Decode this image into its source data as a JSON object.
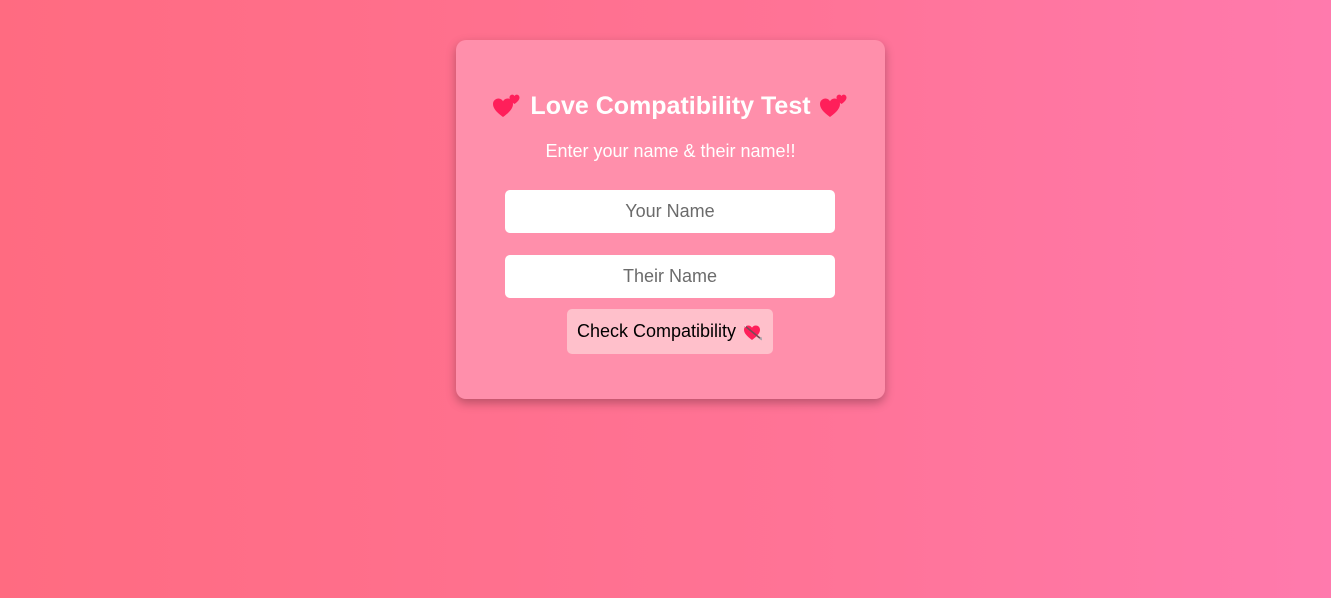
{
  "card": {
    "title": "Love Compatibility Test",
    "title_icon": "two-hearts-icon",
    "subtitle": "Enter your name & their name!!"
  },
  "form": {
    "your_name_placeholder": "Your Name",
    "your_name_value": "",
    "their_name_placeholder": "Their Name",
    "their_name_value": "",
    "submit_label": "Check Compatibility",
    "submit_icon": "heart-with-arrow-icon"
  },
  "colors": {
    "background_start": "#ff6b81",
    "background_end": "#ff7aad",
    "card_background": "#ff8fab",
    "button_background": "#ffc0cb",
    "heart": "#ff1f5a"
  }
}
